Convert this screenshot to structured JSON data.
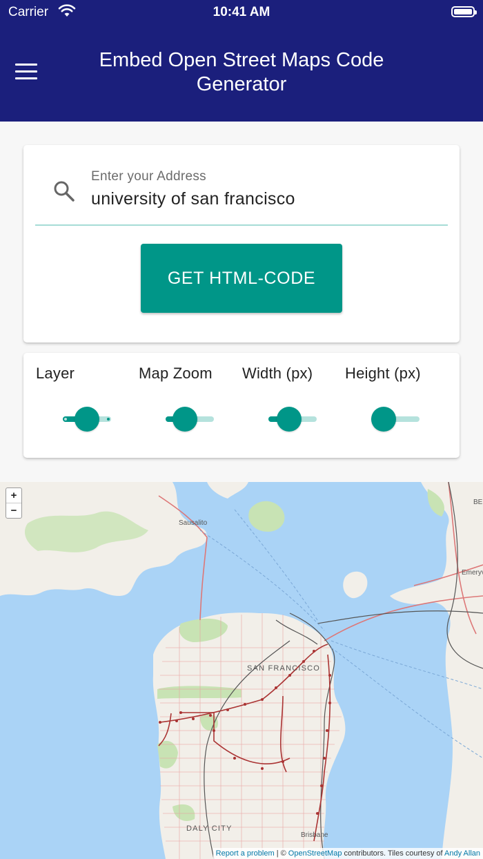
{
  "status_bar": {
    "carrier": "Carrier",
    "time": "10:41 AM"
  },
  "header": {
    "title": "Embed Open Street Maps Code Generator"
  },
  "search": {
    "label": "Enter your Address",
    "value": "university of san francisco",
    "button": "GET HTML-CODE"
  },
  "controls": [
    {
      "label": "Layer",
      "value": 0.5
    },
    {
      "label": "Map Zoom",
      "value": 0.4
    },
    {
      "label": "Width (px)",
      "value": 0.42
    },
    {
      "label": "Height (px)",
      "value": 0.17
    }
  ],
  "map": {
    "zoom_in": "+",
    "zoom_out": "−",
    "labels": {
      "sausalito": "Sausalito",
      "san_francisco": "SAN FRANCISCO",
      "daly_city": "DALY CITY",
      "brisbane": "Brisbane",
      "emeryville": "Emeryvi",
      "berkeley": "BE"
    },
    "attribution": {
      "report": "Report a problem",
      "sep": " | © ",
      "osm": "OpenStreetMap",
      "mid": " contributors. Tiles courtesy of ",
      "author": "Andy Allan"
    }
  },
  "colors": {
    "header": "#1b1f7c",
    "accent": "#009688",
    "water": "#aad3f6",
    "land": "#f2efe9",
    "park": "#c8e3b4"
  }
}
